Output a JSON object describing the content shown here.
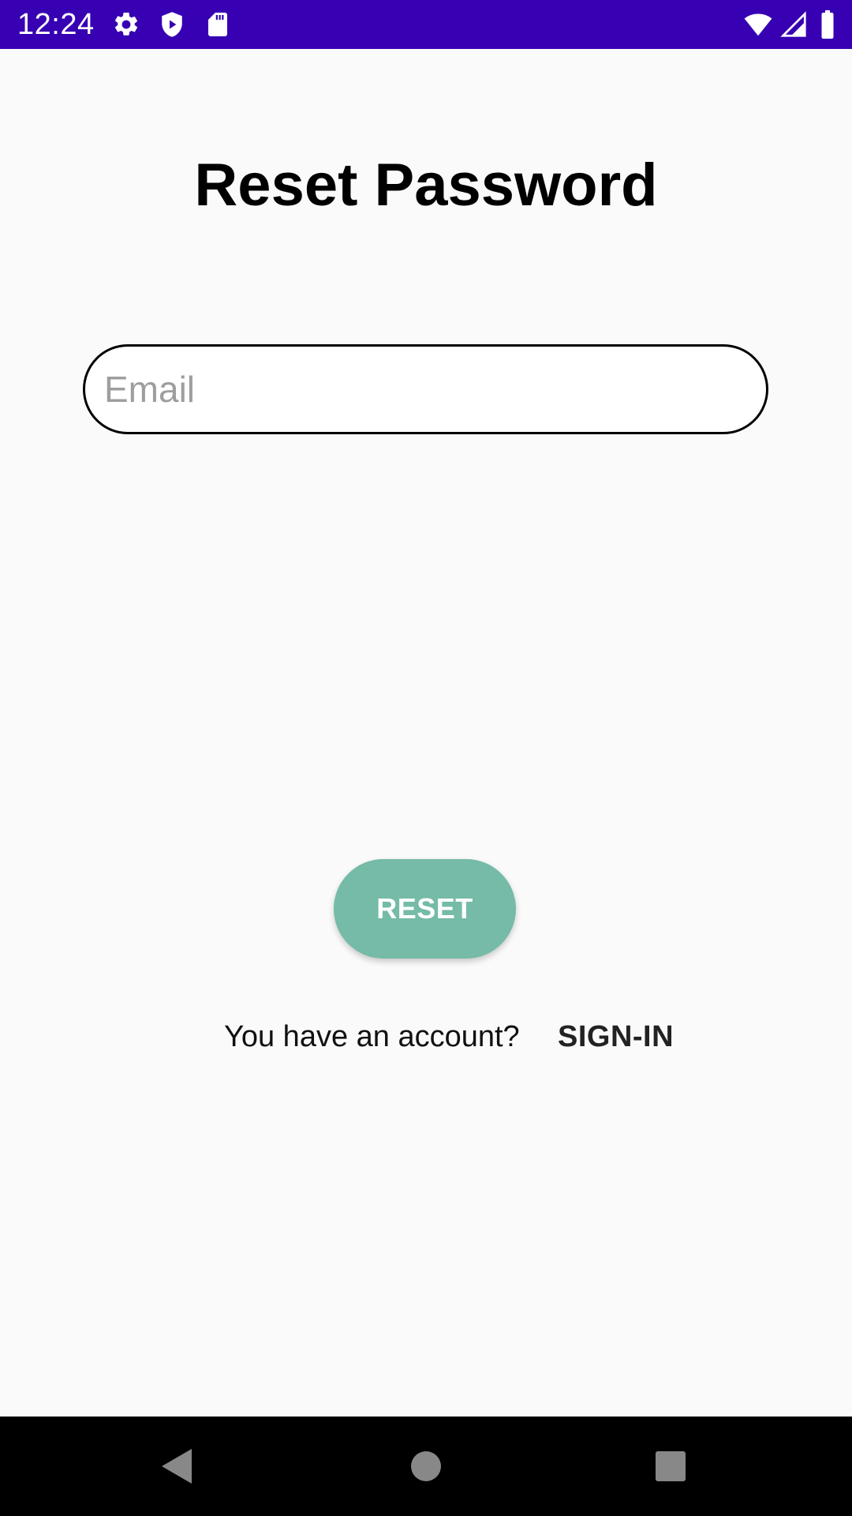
{
  "status_bar": {
    "time": "12:24",
    "background": "#3700B3",
    "left_icons": [
      "settings-icon",
      "shield-play-icon",
      "sd-card-icon"
    ],
    "right_icons": [
      "wifi-icon",
      "cellular-signal-icon",
      "battery-icon"
    ]
  },
  "screen": {
    "title": "Reset Password",
    "email": {
      "placeholder": "Email",
      "value": ""
    },
    "reset_button": {
      "label": "RESET",
      "color": "#75BBA7"
    },
    "signin_prompt": "You have an account?",
    "signin_link": "SIGN-IN"
  },
  "nav_bar": {
    "buttons": [
      "back-icon",
      "home-icon",
      "recents-icon"
    ]
  }
}
